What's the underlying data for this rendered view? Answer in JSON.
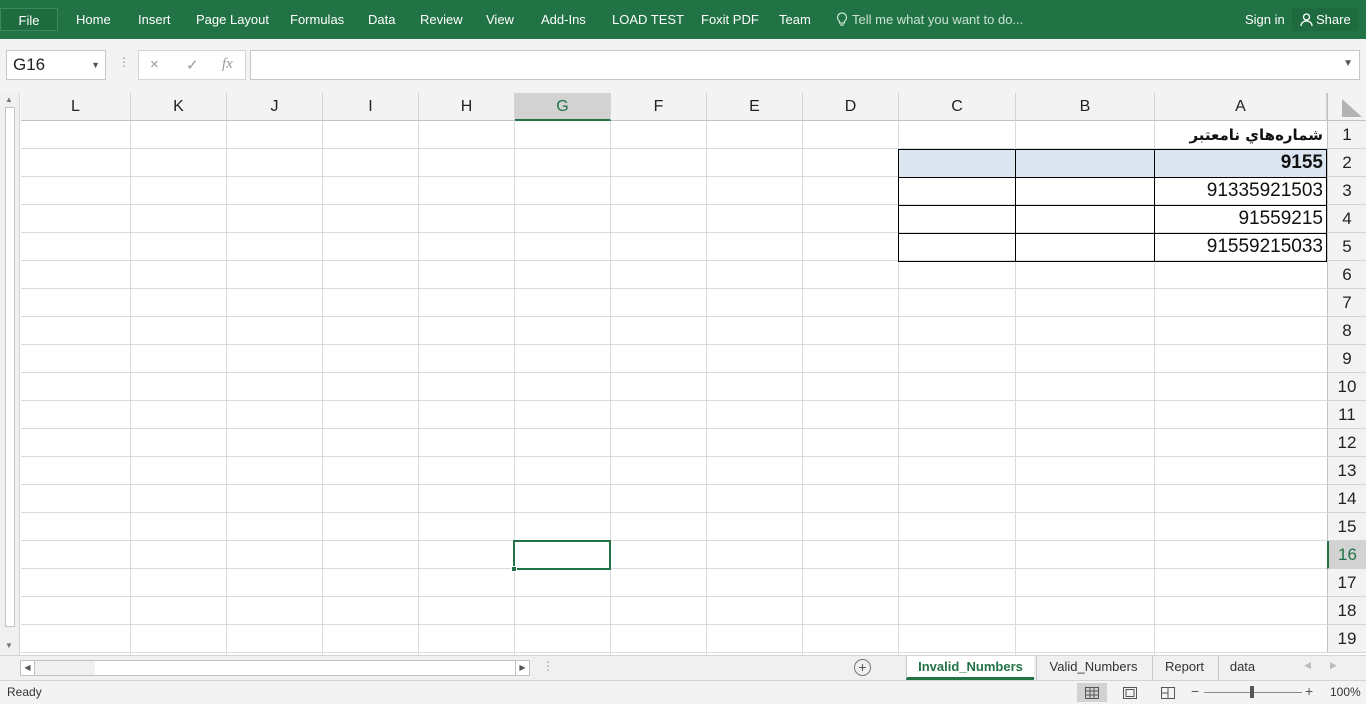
{
  "ribbon": {
    "file": "File",
    "tabs": [
      {
        "label": "Home"
      },
      {
        "label": "Insert"
      },
      {
        "label": "Page Layout"
      },
      {
        "label": "Formulas"
      },
      {
        "label": "Data"
      },
      {
        "label": "Review"
      },
      {
        "label": "View"
      },
      {
        "label": "Add-Ins"
      },
      {
        "label": "LOAD TEST"
      },
      {
        "label": "Foxit PDF"
      },
      {
        "label": "Team"
      }
    ],
    "tell_me": "Tell me what you want to do...",
    "sign_in": "Sign in",
    "share": "Share"
  },
  "formula_bar": {
    "name_box": "G16",
    "cancel_icon": "×",
    "enter_icon": "✓",
    "fx_label": "fx",
    "value": ""
  },
  "columns": [
    "L",
    "K",
    "J",
    "I",
    "H",
    "G",
    "F",
    "E",
    "D",
    "C",
    "B",
    "A"
  ],
  "selected_column": "G",
  "rows": [
    "1",
    "2",
    "3",
    "4",
    "5",
    "6",
    "7",
    "8",
    "9",
    "10",
    "11",
    "12",
    "13",
    "14",
    "15",
    "16",
    "17",
    "18",
    "19"
  ],
  "selected_row": "16",
  "cells": {
    "A1": "شماره‌هاي نامعتبر",
    "A2": "9155",
    "A3": "91335921503",
    "A4": "91559215",
    "A5": "91559215033"
  },
  "sheets": [
    {
      "name": "Invalid_Numbers",
      "active": true
    },
    {
      "name": "Valid_Numbers",
      "active": false
    },
    {
      "name": "Report",
      "active": false
    },
    {
      "name": "data",
      "active": false
    }
  ],
  "status": {
    "ready": "Ready",
    "zoom": "100%"
  },
  "colors": {
    "accent": "#217346",
    "table_header_fill": "#dce6f1"
  }
}
